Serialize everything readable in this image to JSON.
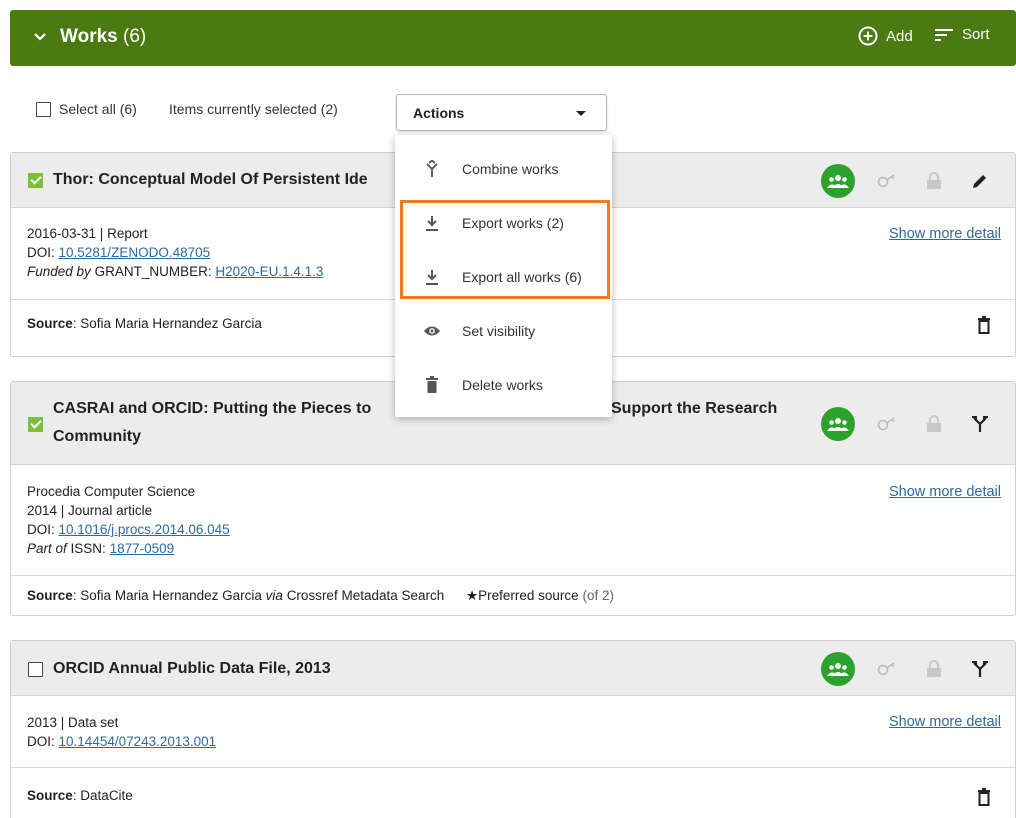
{
  "header": {
    "title": "Works",
    "count": "(6)",
    "add_label": "Add",
    "sort_label": "Sort",
    "bg_color": "#4b7a12"
  },
  "toolbar": {
    "select_all_label": "Select all (6)",
    "selected_text": "Items currently selected (2)",
    "actions_label": "Actions"
  },
  "actions_menu": [
    {
      "icon": "combine-icon",
      "label": "Combine works"
    },
    {
      "icon": "download-icon",
      "label": "Export works (2)"
    },
    {
      "icon": "download-icon",
      "label": "Export all works (6)"
    },
    {
      "icon": "eye-icon",
      "label": "Set visibility"
    },
    {
      "icon": "trash-icon",
      "label": "Delete works"
    }
  ],
  "works": [
    {
      "title": "Thor: Conceptual Model Of Persistent Ide",
      "checked": true,
      "date_type": "2016-03-31 | Report",
      "doi_label": "DOI:",
      "doi": "10.5281/ZENODO.48705",
      "funded_prefix": "Funded by",
      "grant_label": "GRANT_NUMBER:",
      "grant": "H2020-EU.1.4.1.3",
      "show_more": "Show more detail",
      "source_label": "Source",
      "source": "Sofia Maria Hernandez Garcia"
    },
    {
      "title_line1": "CASRAI and ORCID: Putting the Pieces to",
      "title_line1b": "Support the Research",
      "title_line2": "Community",
      "checked": true,
      "journal": "Procedia Computer Science",
      "date_type": "2014 | Journal article",
      "doi_label": "DOI:",
      "doi": "10.1016/j.procs.2014.06.045",
      "part_of": "Part of",
      "issn_label": "ISSN:",
      "issn": "1877-0509",
      "show_more": "Show more detail",
      "source_label": "Source",
      "source": "Sofia Maria Hernandez Garcia",
      "via": "via",
      "via_source": "Crossref Metadata Search",
      "preferred": "Preferred source",
      "preferred_count": "(of 2)"
    },
    {
      "title": "ORCID Annual Public Data File, 2013",
      "checked": false,
      "date_type": "2013 | Data set",
      "doi_label": "DOI:",
      "doi": "10.14454/07243.2013.001",
      "show_more": "Show more detail",
      "source_label": "Source",
      "source": "DataCite"
    }
  ],
  "colors": {
    "accent_orange": "#ef7d1f",
    "visibility_green": "#2ca12c",
    "link_blue": "#2e6a9e",
    "check_green": "#7bbf3a"
  }
}
